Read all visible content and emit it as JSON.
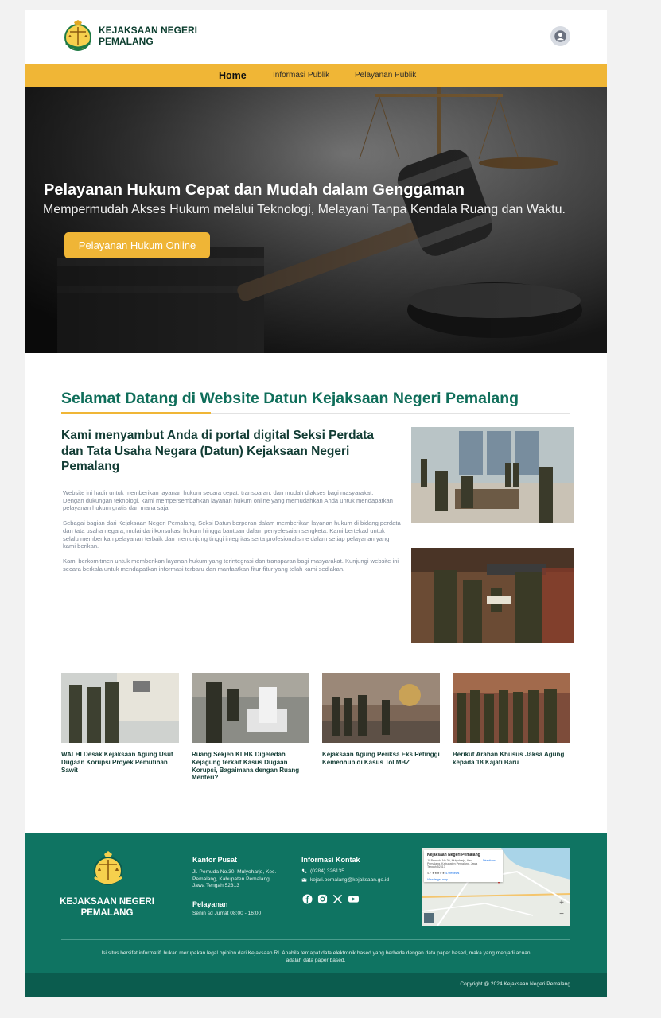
{
  "header": {
    "brand_line1": "KEJAKSAAN NEGERI",
    "brand_line2": "PEMALANG",
    "user_icon": "user-circle-icon"
  },
  "nav": {
    "items": [
      {
        "label": "Home",
        "active": true
      },
      {
        "label": "Informasi Publik",
        "active": false
      },
      {
        "label": "Pelayanan Publik",
        "active": false
      }
    ]
  },
  "hero": {
    "title": "Pelayanan Hukum Cepat dan Mudah dalam Genggaman",
    "subtitle": "Mempermudah Akses Hukum melalui Teknologi, Melayani Tanpa Kendala Ruang dan Waktu.",
    "button": "Pelayanan Hukum Online"
  },
  "welcome": {
    "title": "Selamat Datang di Website Datun Kejaksaan Negeri Pemalang",
    "heading": "Kami menyambut Anda di portal digital Seksi Perdata dan Tata Usaha Negara (Datun) Kejaksaan Negeri Pemalang",
    "paragraphs": [
      "Website ini hadir untuk memberikan layanan hukum secara cepat, transparan, dan mudah diakses bagi masyarakat.\nDengan dukungan teknologi, kami mempersembahkan layanan hukum online yang memudahkan Anda untuk mendapatkan pelayanan hukum gratis dari mana saja.",
      "Sebagai bagian dari Kejaksaan Negeri Pemalang, Seksi Datun berperan dalam memberikan layanan hukum di bidang perdata dan tata usaha negara, mulai dari konsultasi hukum hingga bantuan dalam penyelesaian sengketa. Kami bertekad untuk selalu memberikan pelayanan terbaik dan menjunjung tinggi integritas serta profesionalisme dalam setiap pelayanan yang kami berikan.",
      "Kami berkomitmen untuk memberikan layanan hukum yang terintegrasi dan transparan bagi masyarakat. Kunjungi website ini secara berkala untuk mendapatkan informasi terbaru dan manfaatkan fitur-fitur yang telah kami sediakan."
    ]
  },
  "news": [
    {
      "title": "WALHI Desak Kejaksaan Agung Usut Dugaan Korupsi Proyek Pemutihan Sawit"
    },
    {
      "title": "Ruang Sekjen KLHK Digeledah Kejagung terkait Kasus Dugaan Korupsi, Bagaimana dengan Ruang Menteri?"
    },
    {
      "title": "Kejaksaan Agung Periksa Eks Petinggi Kemenhub di Kasus Tol MBZ"
    },
    {
      "title": "Berikut Arahan Khusus Jaksa Agung kepada 18 Kajati Baru"
    }
  ],
  "footer": {
    "brand_line1": "KEJAKSAAN NEGERI",
    "brand_line2": "PEMALANG",
    "office_title": "Kantor Pusat",
    "office_address": "Jl. Pemuda No.30, Mulyoharjo, Kec. Pemalang, Kabupaten Pemalang, Jawa Tengah 52313",
    "service_title": "Pelayanan",
    "service_hours": "Senin sd Jumat 08:00 - 16:00",
    "contact_title": "Informasi Kontak",
    "phone": "(0284) 326135",
    "email": "kejari.pemalang@kejaksaan.go.id",
    "socials": [
      "facebook-icon",
      "instagram-icon",
      "x-icon",
      "youtube-icon"
    ],
    "map": {
      "place": "Kejaksaan Negeri Pemalang",
      "address": "Jl. Pemuda No.30, Mulyoharjo, Kec. Pemalang, Kabupaten Pemalang, Jawa Tengah 52313",
      "rating": "4.7 ★★★★★",
      "reviews": "47 reviews",
      "directions": "Directions",
      "larger_map": "View larger map"
    },
    "disclaimer": "Isi situs bersifat informatif, bukan merupakan legal opinion dari Kejaksaan RI. Apabila terdapat data elektronik based yang berbeda dengan data paper based, maka yang menjadi acuan adalah data paper based.",
    "copyright": "Copyright @ 2024 Kejaksaan Negeri Pemalang"
  },
  "colors": {
    "accent": "#f0b636",
    "brand_green": "#0f7462",
    "footer_dark": "#0b5c4e",
    "title_green": "#0f6e5a"
  }
}
